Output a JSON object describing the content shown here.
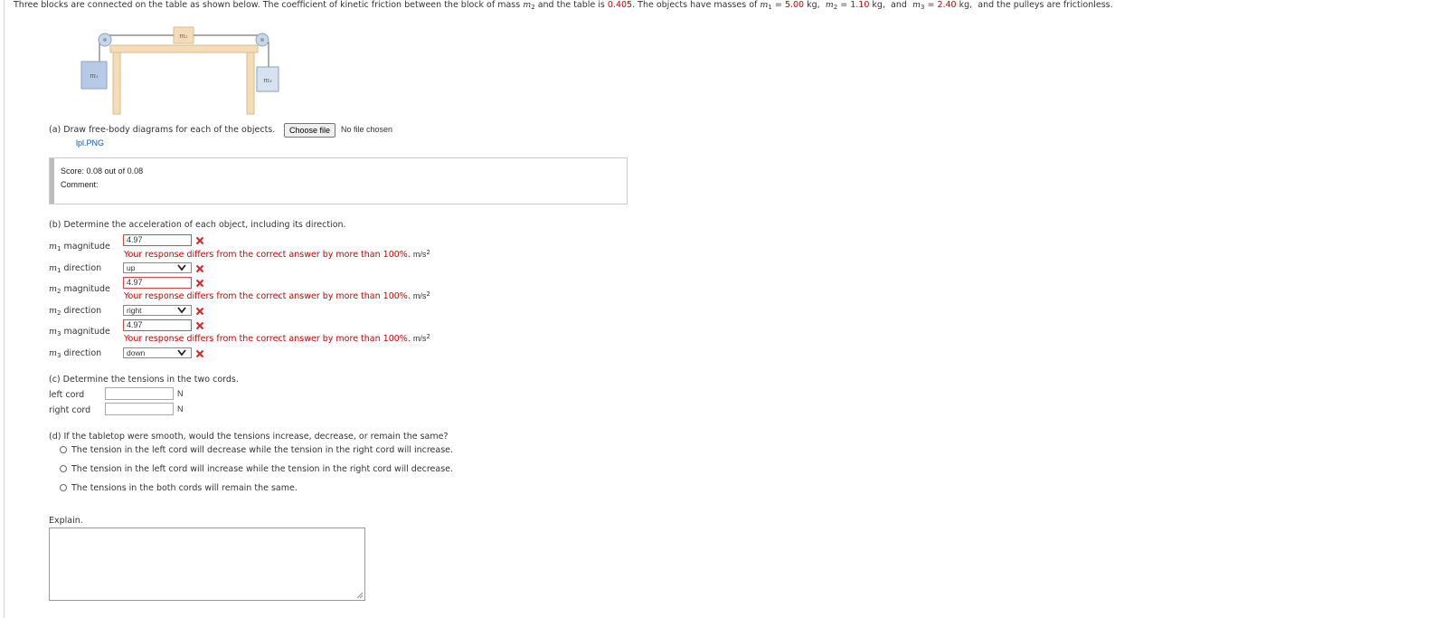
{
  "problem": {
    "intro_before_mu": "Three blocks are connected on the table as shown below. The coefficient of kinetic friction between the block of mass ",
    "intro_mass_var": "m",
    "intro_mass_sub": "2",
    "intro_mid": " and the table is ",
    "mu_value": "0.405",
    "intro_after_mu": ". The objects have masses of ",
    "m1_label": "m",
    "m1_sub": "1",
    "m1_value": "5.00",
    "m2_label": "m",
    "m2_sub": "2",
    "m2_value": "1.10",
    "m3_label": "m",
    "m3_sub": "3",
    "m3_value": "2.40",
    "kg_unit": "kg,",
    "and_text": "and",
    "equals": "=",
    "intro_end": "and the pulleys are frictionless.",
    "accent_color": "#cc0000"
  },
  "figure": {
    "m1": "m₁",
    "m2": "m₂",
    "m3": "m₃",
    "block_color": "#b6c9e6",
    "table_color": "#f3dcb6"
  },
  "part_a": {
    "prompt": "(a) Draw free-body diagrams for each of the objects.",
    "choose_file_label": "Choose file",
    "file_status": "No file chosen",
    "uploaded_file": "lpl.PNG",
    "score_label": "Score:",
    "score_value": "0.08 out of 0.08",
    "comment_label": "Comment:"
  },
  "part_b": {
    "prompt": "(b) Determine the acceleration of each object, including its direction.",
    "error_text": "Your response differs from the correct answer by more than 100%.",
    "unit": "m/s",
    "unit_exp": "2",
    "rows": [
      {
        "label_var": "m",
        "label_sub": "1",
        "label_text": "magnitude",
        "value": "4.97"
      },
      {
        "label_var": "m",
        "label_sub": "1",
        "label_text": "direction",
        "value": "up"
      },
      {
        "label_var": "m",
        "label_sub": "2",
        "label_text": "magnitude",
        "value": "4.97"
      },
      {
        "label_var": "m",
        "label_sub": "2",
        "label_text": "direction",
        "value": "right"
      },
      {
        "label_var": "m",
        "label_sub": "3",
        "label_text": "magnitude",
        "value": "4.97"
      },
      {
        "label_var": "m",
        "label_sub": "3",
        "label_text": "direction",
        "value": "down"
      }
    ]
  },
  "part_c": {
    "prompt": "(c) Determine the tensions in the two cords.",
    "left_label": "left cord",
    "right_label": "right cord",
    "left_value": "",
    "right_value": "",
    "unit": "N"
  },
  "part_d": {
    "prompt": "(d) If the tabletop were smooth, would the tensions increase, decrease, or remain the same?",
    "options": [
      "The tension in the left cord will decrease while the tension in the right cord will increase.",
      "The tension in the left cord will increase while the tension in the right cord will decrease.",
      "The tensions in the both cords will remain the same."
    ],
    "explain_label": "Explain."
  }
}
